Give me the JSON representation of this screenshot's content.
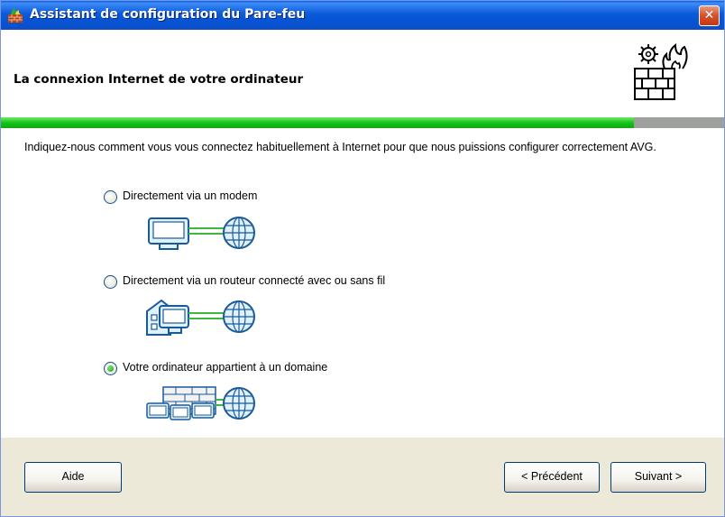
{
  "window": {
    "title": "Assistant de configuration du Pare-feu",
    "close_label": "✕"
  },
  "header": {
    "title": "La connexion Internet de votre ordinateur"
  },
  "progress": {
    "fraction": 0.875,
    "color": "#18c418"
  },
  "intro_text": "Indiquez-nous comment vous vous connectez habituellement à Internet pour que nous puissions configurer correctement AVG.",
  "options": [
    {
      "label": "Directement via un modem",
      "selected": false,
      "icon": "computer-to-globe-icon"
    },
    {
      "label": "Directement via un routeur connecté avec ou sans fil",
      "selected": false,
      "icon": "home-computer-to-globe-icon"
    },
    {
      "label": "Votre ordinateur appartient à un domaine",
      "selected": true,
      "icon": "network-computers-to-globe-icon"
    }
  ],
  "buttons": {
    "help": "Aide",
    "previous": "< Précédent",
    "next": "Suivant >"
  }
}
